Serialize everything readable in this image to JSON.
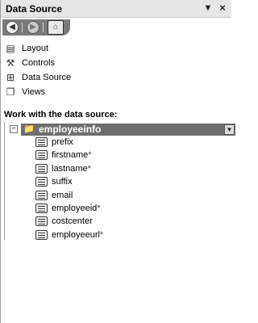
{
  "panel": {
    "title": "Data Source",
    "menu_glyph": "▼",
    "close_glyph": "×"
  },
  "nav": {
    "back_glyph": "◀",
    "forward_glyph": "▶",
    "home_glyph": "⌂"
  },
  "links": [
    {
      "label": "Layout",
      "icon": "layout-icon",
      "glyph": "▤"
    },
    {
      "label": "Controls",
      "icon": "controls-icon",
      "glyph": "⚒"
    },
    {
      "label": "Data Source",
      "icon": "data-source-icon",
      "glyph": "⊞"
    },
    {
      "label": "Views",
      "icon": "views-icon",
      "glyph": "❐"
    }
  ],
  "section": {
    "heading": "Work with the data source:"
  },
  "tree": {
    "expander": "−",
    "root": {
      "label": "employeeinfo",
      "icon_glyph": "📁",
      "dropdown_glyph": "▼"
    },
    "fields": [
      {
        "label": "prefix",
        "required": ""
      },
      {
        "label": "firstname",
        "required": "*"
      },
      {
        "label": "lastname",
        "required": "*"
      },
      {
        "label": "suffix",
        "required": ""
      },
      {
        "label": "email",
        "required": ""
      },
      {
        "label": "employeeid",
        "required": "*"
      },
      {
        "label": "costcenter",
        "required": ""
      },
      {
        "label": "employeeurl",
        "required": "*"
      }
    ]
  }
}
